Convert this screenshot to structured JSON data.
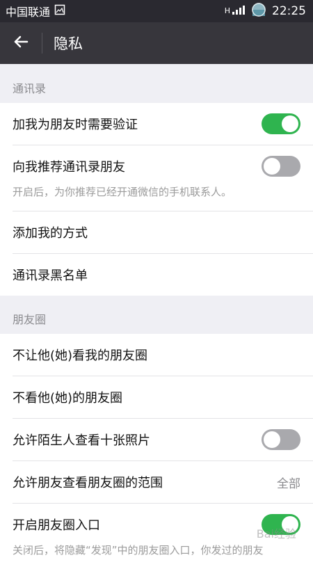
{
  "status_bar": {
    "carrier": "中国联通",
    "network": "H",
    "time": "22:25"
  },
  "nav": {
    "title": "隐私",
    "back_icon": "arrow-left-icon"
  },
  "sections": {
    "contacts": {
      "header": "通讯录",
      "items": [
        {
          "label": "加我为朋友时需要验证",
          "toggle": true
        },
        {
          "label": "向我推荐通讯录朋友",
          "toggle": false,
          "sub": "开启后，为你推荐已经开通微信的手机联系人。"
        },
        {
          "label": "添加我的方式"
        },
        {
          "label": "通讯录黑名单"
        }
      ]
    },
    "moments": {
      "header": "朋友圈",
      "items": [
        {
          "label": "不让他(她)看我的朋友圈"
        },
        {
          "label": "不看他(她)的朋友圈"
        },
        {
          "label": "允许陌生人查看十张照片",
          "toggle": false
        },
        {
          "label": "允许朋友查看朋友圈的范围",
          "value": "全部"
        },
        {
          "label": "开启朋友圈入口",
          "toggle": true,
          "sub": "关闭后，将隐藏“发现”中的朋友圈入口，你发过的朋友"
        }
      ]
    }
  },
  "watermark": "Bai经验",
  "colors": {
    "toggle_on": "#2fb44f",
    "toggle_off": "#a9a9ad",
    "nav_bg": "#37363c",
    "status_bg": "#2a2930",
    "page_bg": "#efeff4"
  }
}
